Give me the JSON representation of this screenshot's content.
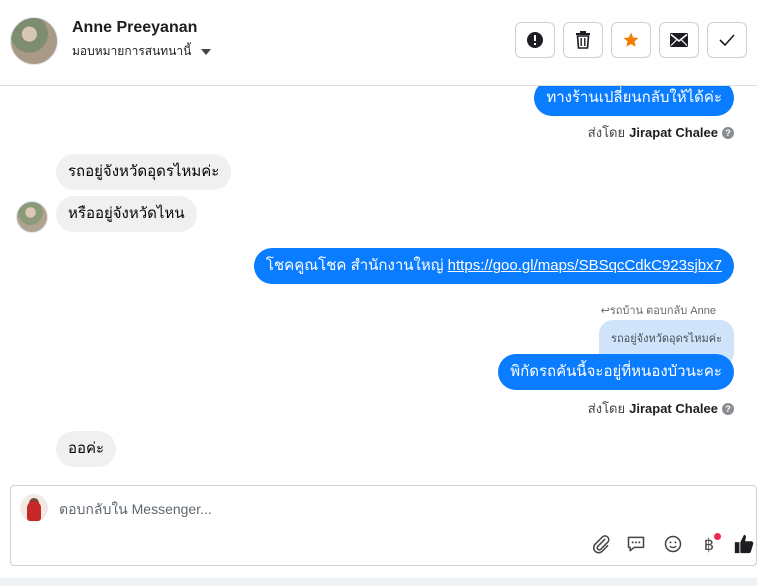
{
  "header": {
    "contact_name": "Anne Preeyanan",
    "assign_label": "มอบหมายการสนทนานี้",
    "buttons": [
      {
        "name": "report-button",
        "icon": "exclamation-icon"
      },
      {
        "name": "delete-button",
        "icon": "trash-icon"
      },
      {
        "name": "star-button",
        "icon": "star-icon"
      },
      {
        "name": "mark-unread-button",
        "icon": "envelope-icon"
      },
      {
        "name": "mark-done-button",
        "icon": "check-icon"
      }
    ]
  },
  "messages": {
    "m1": "ทางร้านเปลี่ยนกลับให้ได้ค่ะ",
    "sent_by_label": "ส่งโดย",
    "agent_name": "Jirapat Chalee",
    "m2": "รถอยู่จังหวัดอุดรไหมค่ะ",
    "m3": "หรืออยู่จังหวัดไหน",
    "m4_text": "โชคคูณโชค สำนักงานใหญ่ ",
    "m4_link": "https://goo.gl/maps/SBSqcCdkC923sjbx7",
    "reply_note": "↩รถบ้าน ตอบกลับ Anne",
    "quoted": "รถอยู่จังหวัดอุดรไหมค่ะ",
    "m5": "พิกัดรถคันนี้จะอยู่ที่หนองบัวนะคะ",
    "m6": "ออค่ะ"
  },
  "composer": {
    "placeholder": "ตอบกลับใน Messenger..."
  },
  "colors": {
    "outgoing": "#0a7cff",
    "incoming": "#f0f0f0",
    "star": "#f57c00",
    "notify": "#f02849"
  }
}
